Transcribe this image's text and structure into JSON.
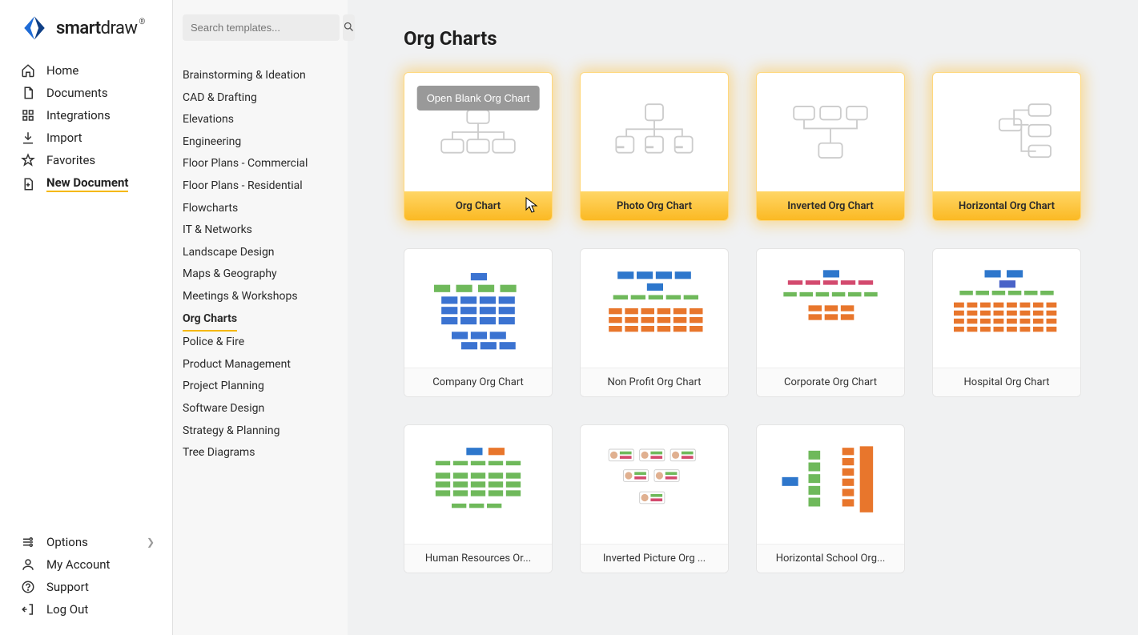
{
  "brand": {
    "name_bold": "smart",
    "name_light": "draw"
  },
  "sidebar": {
    "items": [
      {
        "label": "Home",
        "icon": "home"
      },
      {
        "label": "Documents",
        "icon": "documents"
      },
      {
        "label": "Integrations",
        "icon": "integrations"
      },
      {
        "label": "Import",
        "icon": "import"
      },
      {
        "label": "Favorites",
        "icon": "favorites"
      },
      {
        "label": "New Document",
        "icon": "new-document",
        "active": true
      }
    ],
    "bottom": [
      {
        "label": "Options",
        "icon": "options",
        "chevron": true
      },
      {
        "label": "My Account",
        "icon": "account"
      },
      {
        "label": "Support",
        "icon": "support"
      },
      {
        "label": "Log Out",
        "icon": "logout"
      }
    ]
  },
  "search": {
    "placeholder": "Search templates..."
  },
  "categories": [
    "Brainstorming & Ideation",
    "CAD & Drafting",
    "Elevations",
    "Engineering",
    "Floor Plans - Commercial",
    "Floor Plans - Residential",
    "Flowcharts",
    "IT & Networks",
    "Landscape Design",
    "Maps & Geography",
    "Meetings & Workshops",
    "Org Charts",
    "Police & Fire",
    "Product Management",
    "Project Planning",
    "Software Design",
    "Strategy & Planning",
    "Tree Diagrams"
  ],
  "active_category": "Org Charts",
  "page_title": "Org Charts",
  "open_blank_label": "Open Blank Org Chart",
  "cards": [
    {
      "label": "Org Chart",
      "blank": true,
      "preview": "tree-gray"
    },
    {
      "label": "Photo Org Chart",
      "blank": true,
      "preview": "photo-tree-gray"
    },
    {
      "label": "Inverted Org Chart",
      "blank": true,
      "preview": "inverted-tree-gray"
    },
    {
      "label": "Horizontal Org Chart",
      "blank": true,
      "preview": "horizontal-tree-gray"
    },
    {
      "label": "Company Org Chart",
      "preview": "company"
    },
    {
      "label": "Non Profit Org Chart",
      "preview": "nonprofit"
    },
    {
      "label": "Corporate Org Chart",
      "preview": "corporate"
    },
    {
      "label": "Hospital Org Chart",
      "preview": "hospital"
    },
    {
      "label": "Human Resources Or...",
      "preview": "hr"
    },
    {
      "label": "Inverted Picture Org ...",
      "preview": "inv-pic"
    },
    {
      "label": "Horizontal School Org...",
      "preview": "school"
    }
  ]
}
